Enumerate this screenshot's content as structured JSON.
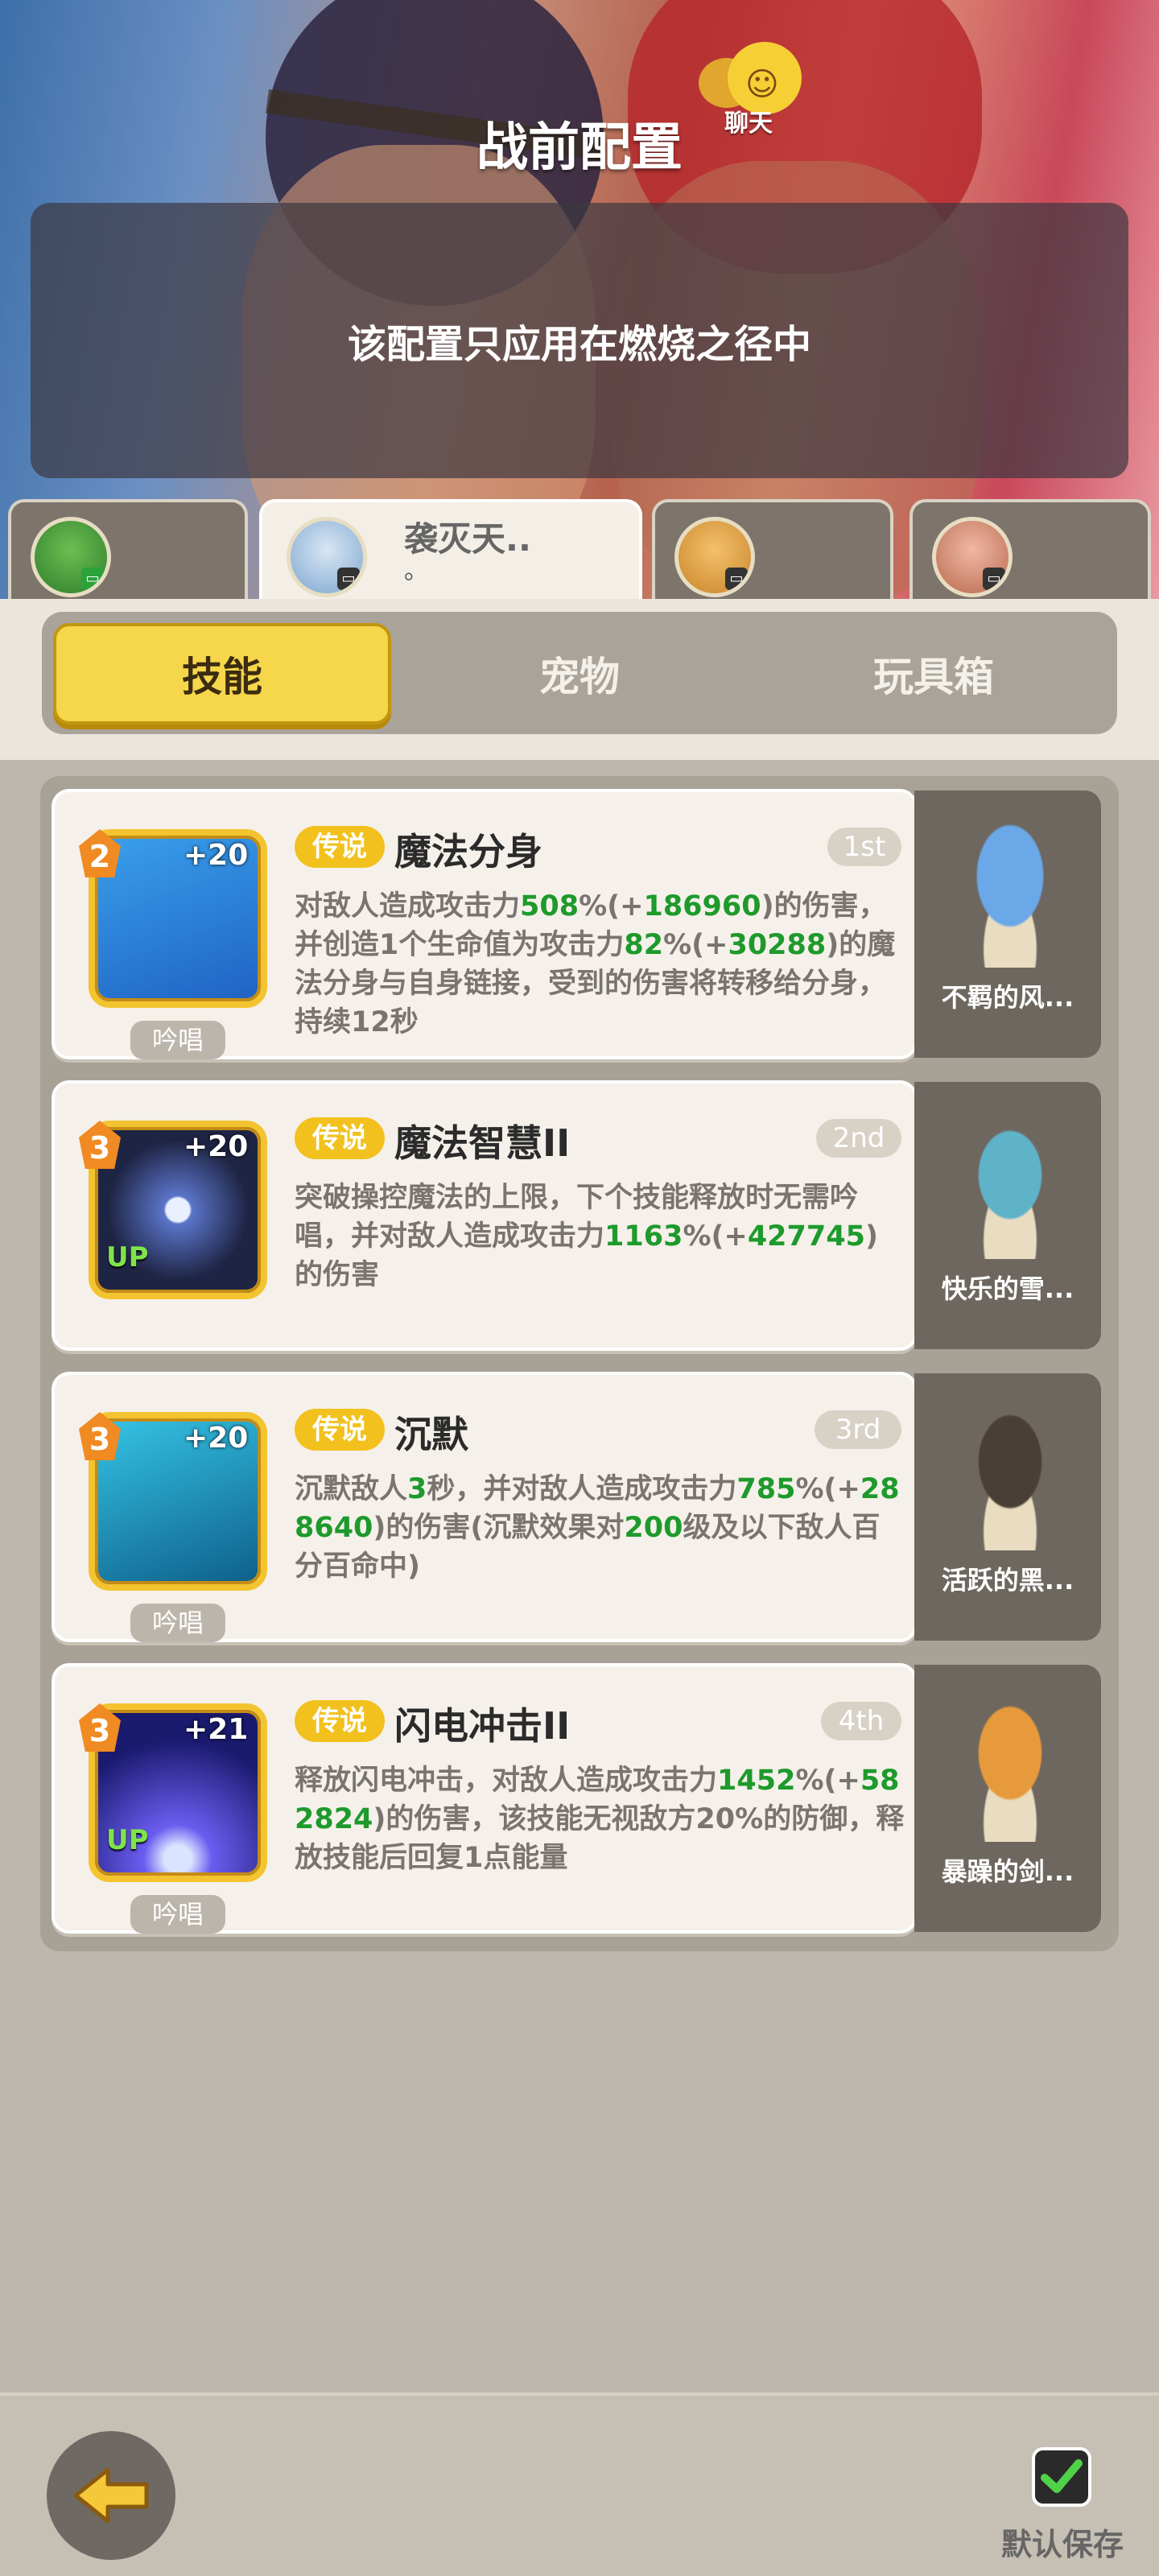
{
  "header": {
    "title": "战前配置",
    "chat_label": "聊天"
  },
  "notice": {
    "text": "该配置只应用在燃烧之径中"
  },
  "partners": [
    {
      "name": ""
    },
    {
      "name": "袭灭天..",
      "line2": "。"
    },
    {
      "name": ""
    },
    {
      "name": ""
    }
  ],
  "tabs": [
    "技能",
    "宠物",
    "玩具箱"
  ],
  "skills": [
    {
      "level": "2",
      "plus": "+20",
      "up": "",
      "cast": "吟唱",
      "tag": "传说",
      "name": "魔法分身",
      "rank": "1st",
      "desc_parts": [
        "对敌人造成攻击力",
        "508",
        "%(+",
        "186960",
        ")的伤害，并创造1个生命值为攻击力",
        "82",
        "%(+",
        "30288",
        ")的魔法分身与自身链接，受到的伤害将转移给分身，持续12秒"
      ],
      "pet_name": "不羁的风..."
    },
    {
      "level": "3",
      "plus": "+20",
      "up": "UP",
      "cast": "",
      "tag": "传说",
      "name": "魔法智慧II",
      "rank": "2nd",
      "desc_parts": [
        "突破操控魔法的上限，下个技能释放时无需吟唱，并对敌人造成攻击力",
        "1163",
        "%(+",
        "427745",
        ")的伤害"
      ],
      "pet_name": "快乐的雪..."
    },
    {
      "level": "3",
      "plus": "+20",
      "up": "",
      "cast": "吟唱",
      "tag": "传说",
      "name": "沉默",
      "rank": "3rd",
      "desc_parts": [
        "沉默敌人",
        "3",
        "秒，并对敌人造成攻击力",
        "785",
        "%(+",
        "288640",
        ")的伤害(沉默效果对",
        "200",
        "级及以下敌人百分百命中)"
      ],
      "pet_name": "活跃的黑..."
    },
    {
      "level": "3",
      "plus": "+21",
      "up": "UP",
      "cast": "吟唱",
      "tag": "传说",
      "name": "闪电冲击II",
      "rank": "4th",
      "desc_parts": [
        "释放闪电冲击，对敌人造成攻击力",
        "1452",
        "%(+",
        "582824",
        ")的伤害，该技能无视敌方20%的防御，释放技能后回复1点能量"
      ],
      "pet_name": "暴躁的剑..."
    }
  ],
  "footer": {
    "save_label": "默认保存"
  }
}
